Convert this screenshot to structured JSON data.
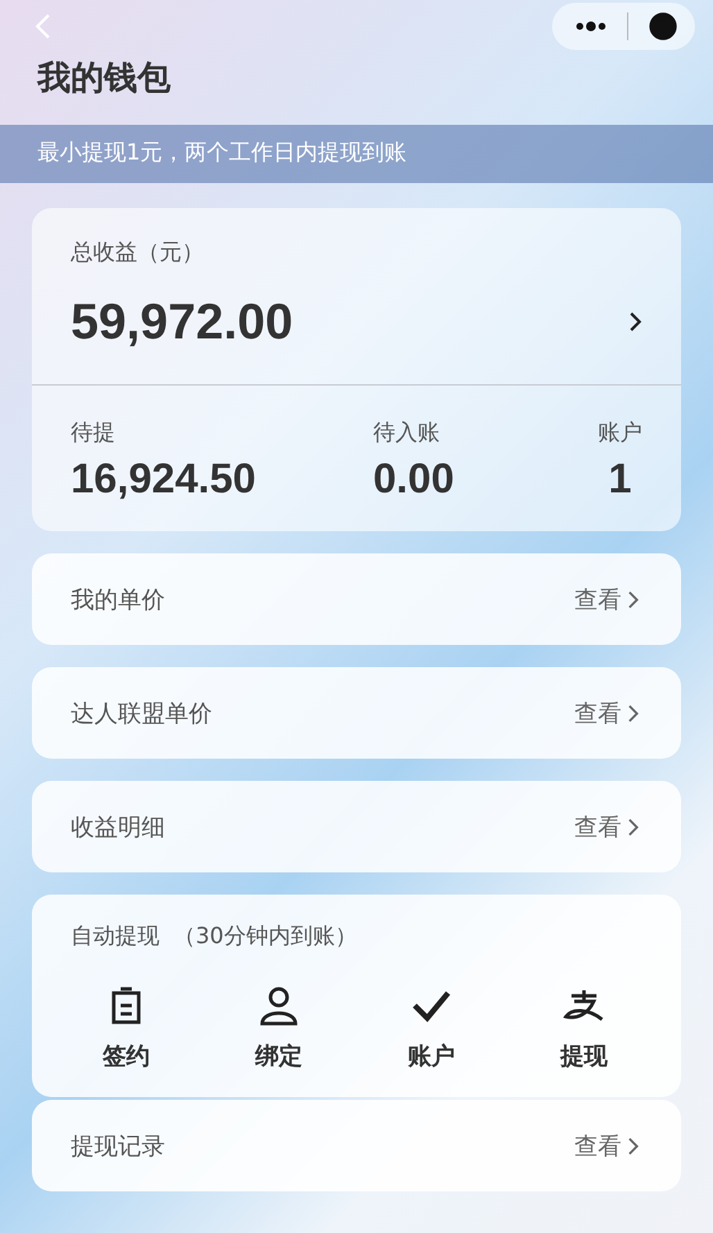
{
  "header": {
    "title": "我的钱包"
  },
  "notice": "最小提现1元，两个工作日内提现到账",
  "summary": {
    "label": "总收益（元）",
    "amount": "59,972.00",
    "stats": [
      {
        "label": "待提",
        "value": "16,924.50"
      },
      {
        "label": "待入账",
        "value": "0.00"
      },
      {
        "label": "账户",
        "value": "1"
      }
    ]
  },
  "rows": [
    {
      "label": "我的单价",
      "action": "查看"
    },
    {
      "label": "达人联盟单价",
      "action": "查看"
    },
    {
      "label": "收益明细",
      "action": "查看"
    }
  ],
  "auto_withdraw": {
    "title": "自动提现",
    "note": "（30分钟内到账）",
    "actions": [
      {
        "kind": "sign",
        "label": "签约"
      },
      {
        "kind": "person",
        "label": "绑定"
      },
      {
        "kind": "check",
        "label": "账户"
      },
      {
        "kind": "alipay",
        "label": "提现"
      }
    ]
  },
  "record_row": {
    "label": "提现记录",
    "action": "查看"
  }
}
